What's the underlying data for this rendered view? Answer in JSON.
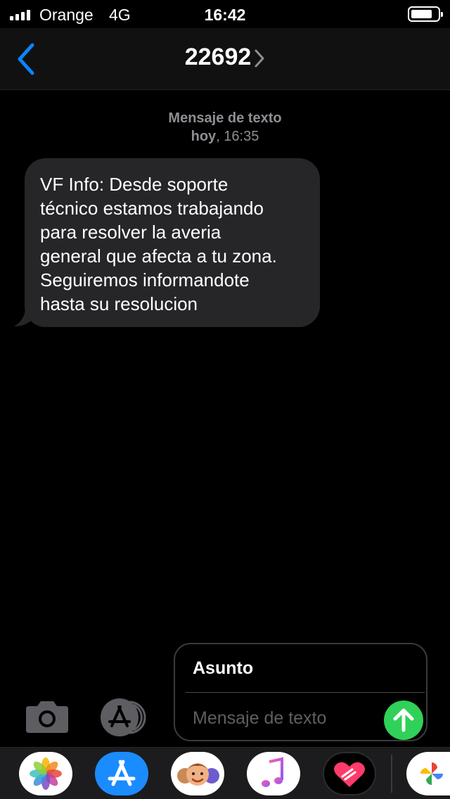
{
  "status_bar": {
    "carrier": "Orange",
    "network": "4G",
    "time": "16:42",
    "battery_level": 0.8
  },
  "nav": {
    "back_icon": "chevron-left-icon",
    "contact": "22692",
    "contact_chevron_icon": "chevron-right-icon"
  },
  "thread": {
    "meta_label": "Mensaje de texto",
    "meta_day": "hoy",
    "meta_time": ", 16:35",
    "message_lines": [
      "VF Info: Desde soporte",
      "técnico estamos trabajando",
      "para resolver la averia",
      "general que afecta a tu zona.",
      "Seguiremos informandote",
      "hasta su resolucion"
    ]
  },
  "input": {
    "subject_label": "Asunto",
    "message_placeholder": "Mensaje de texto",
    "camera_icon": "camera-icon",
    "appstore_icon": "app-store-icon",
    "send_icon": "arrow-up-icon"
  },
  "app_drawer": {
    "apps": [
      "photos",
      "app-store",
      "memoji",
      "music",
      "digital-touch",
      "google-photos"
    ]
  },
  "colors": {
    "accent": "#0a84ff",
    "bubble": "#262628",
    "send": "#30d158",
    "meta_text": "#8e8e93"
  }
}
